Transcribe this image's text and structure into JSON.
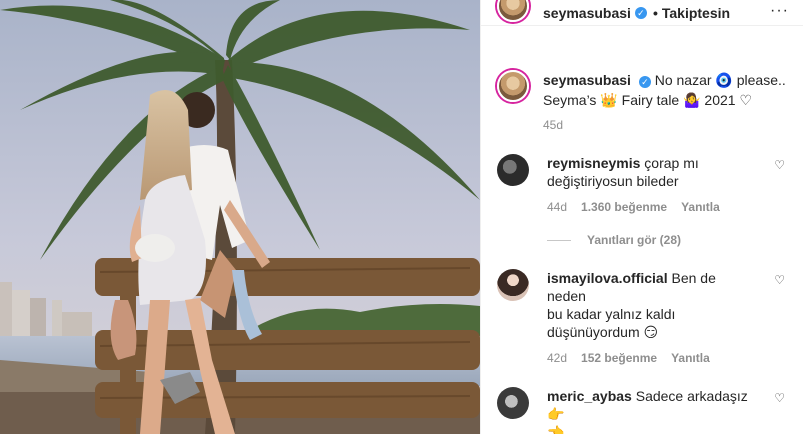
{
  "post": {
    "username": "seymasubasi",
    "separator": "•",
    "follow_status": "Takiptesin",
    "more": "···"
  },
  "caption": {
    "username": "seymasubasi",
    "line1": "No nazar 🧿 please..",
    "line2": "Seyma’s 👑 Fairy tale 🤷‍♀️ 2021 ♡",
    "time": "45d"
  },
  "comments": [
    {
      "username": "reymisneymis",
      "text_l1": "çorap mı",
      "text_l2": "değiştiriyosun bileder",
      "time": "44d",
      "likes": "1.360 beğenme",
      "reply": "Yanıtla",
      "view_replies": "Yanıtları gör (28)"
    },
    {
      "username": "ismayilova.official",
      "text_l1": "Ben de neden",
      "text_l2": "bu kadar yalnız kaldı",
      "text_l3": "düşünüyordum 😏",
      "time": "42d",
      "likes": "152 beğenme",
      "reply": "Yanıtla"
    },
    {
      "username": "meric_aybas",
      "text_l1": "Sadece arkadaşız 👉",
      "text_l2": "👈"
    }
  ],
  "icons": {
    "verified": "verified-badge-icon",
    "heart": "heart-outline-icon",
    "more": "more-options-icon"
  },
  "colors": {
    "verified_blue": "#3897f0",
    "secondary_text": "#8e8e8e",
    "story_ring": "#d6249f"
  }
}
